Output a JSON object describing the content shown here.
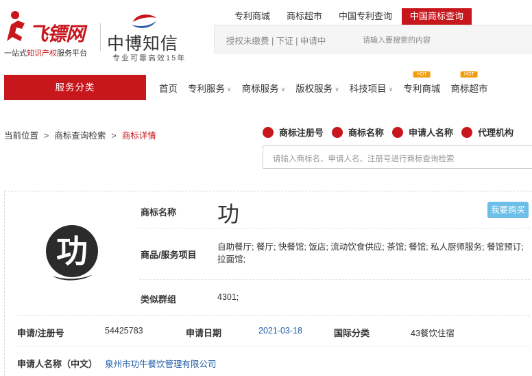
{
  "header": {
    "logo_feibiao": "飞镖网",
    "logo_slogan_prefix": "一站式",
    "logo_slogan_highlight": "知识产权",
    "logo_slogan_suffix": "服务平台",
    "logo_zhongbo": "中博知信",
    "logo_zhongbo_sub": "专业可靠高效15年",
    "top_tabs": [
      "专利商城",
      "商标超市",
      "中国专利查询",
      "中国商标查询"
    ],
    "active_tab_index": 3,
    "search_tip": "授权未缴费 | 下证 | 申请中",
    "search_placeholder": "请输入要搜索的内容"
  },
  "nav": {
    "service_label": "服务分类",
    "items": [
      {
        "label": "首页",
        "dropdown": false,
        "hot": ""
      },
      {
        "label": "专利服务",
        "dropdown": true,
        "hot": ""
      },
      {
        "label": "商标服务",
        "dropdown": true,
        "hot": ""
      },
      {
        "label": "版权服务",
        "dropdown": true,
        "hot": ""
      },
      {
        "label": "科技项目",
        "dropdown": true,
        "hot": ""
      },
      {
        "label": "专利商城",
        "dropdown": false,
        "hot": "HOT"
      },
      {
        "label": "商标超市",
        "dropdown": false,
        "hot": "HOT"
      }
    ]
  },
  "breadcrumb": {
    "items": [
      "当前位置",
      "商标查询检索",
      "商标详情"
    ],
    "separator": ">"
  },
  "search_types": [
    "商标注册号",
    "商标名称",
    "申请人名称",
    "代理机构"
  ],
  "query_placeholder": "请输入商标名、申请人名、注册号进行商标查询检索",
  "trademark": {
    "image_glyph": "功",
    "name_label": "商标名称",
    "name": "功",
    "buy_label": "我要购买",
    "goods_label": "商品/服务项目",
    "goods": "自助餐厅; 餐厅; 快餐馆; 饭店; 流动饮食供应; 茶馆; 餐馆; 私人厨师服务; 餐馆预订; 拉面馆;",
    "group_label": "类似群组",
    "group": "4301;",
    "reg_no_label": "申请/注册号",
    "reg_no": "54425783",
    "date_label": "申请日期",
    "date": "2021-03-18",
    "class_label": "国际分类",
    "class": "43餐饮住宿",
    "applicant_label": "申请人名称（中文）",
    "applicant": "泉州市功牛餐饮管理有限公司"
  },
  "colors": {
    "brand_red": "#c8161d",
    "buy_blue": "#6cbfe6",
    "link_blue": "#1f5ca8",
    "hot_orange": "#f39c12"
  }
}
